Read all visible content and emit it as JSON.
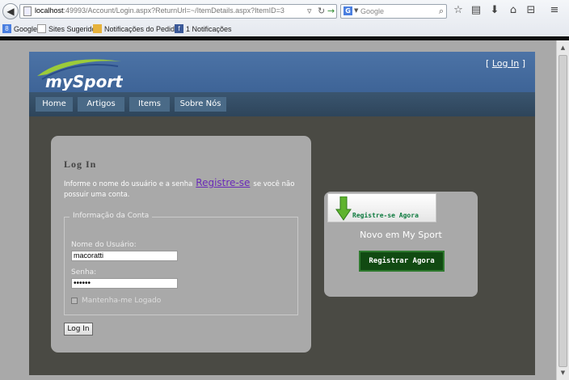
{
  "browser": {
    "url_host": "localhost",
    "url_rest": ":49993/Account/Login.aspx?ReturnUrl=~/ItemDetails.aspx?ItemID=3",
    "search_engine_icon": "G",
    "search_placeholder": "Google",
    "bookmarks": [
      {
        "label": "Google",
        "icon": "google-icon"
      },
      {
        "label": "Sites Sugeridos",
        "icon": "page-icon"
      },
      {
        "label": "Notificações do Pedid...",
        "icon": "folder-icon"
      },
      {
        "label": "1 Notificações",
        "icon": "facebook-icon"
      }
    ]
  },
  "site": {
    "logo_text": "mySport",
    "header_login_prefix": "[",
    "header_login_link": "Log In",
    "header_login_suffix": "]",
    "menu": [
      {
        "label": "Home"
      },
      {
        "label": "Artigos"
      },
      {
        "label": "Items"
      },
      {
        "label": "Sobre Nós"
      }
    ]
  },
  "login": {
    "title": "Log In",
    "desc_before": "Informe o nome do usuário e a senha",
    "register_link": "Registre-se",
    "desc_after": "se você não possuir uma conta.",
    "legend": "Informação da Conta",
    "username_label": "Nome do Usuário:",
    "username_value": "macoratti",
    "password_label": "Senha:",
    "password_value": "••••••",
    "remember_label": "Mantenha-me Logado",
    "submit_label": "Log In"
  },
  "register": {
    "banner_text": "Registre-se Agora",
    "title": "Novo em My Sport",
    "button_label": "Registrar Agora"
  },
  "colors": {
    "header_blue": "#4c73a6",
    "page_bg": "#4a4a44",
    "box_gray": "#a9a9a9",
    "link_purple": "#6a2ab8",
    "register_green": "#114a12"
  }
}
